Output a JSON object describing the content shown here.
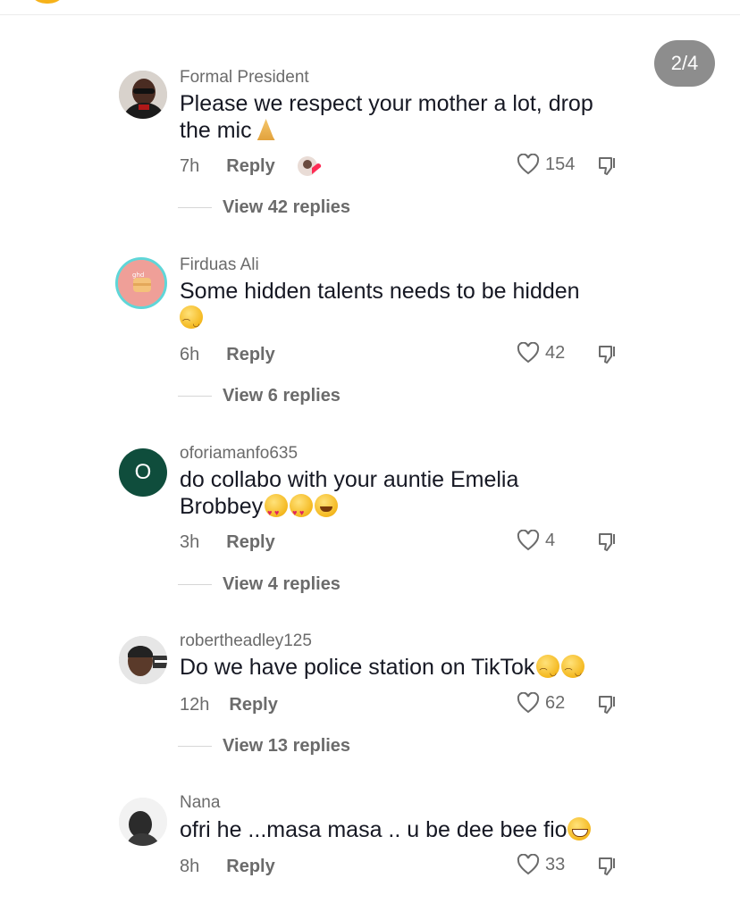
{
  "page_indicator": "2/4",
  "comments": [
    {
      "username": "Formal President",
      "text": "Please we respect your mother a lot, drop the mic",
      "text_line1": "Please we respect your mother a lot, drop",
      "text_line2": "the mic",
      "emoji": "folded-hands",
      "time": "7h",
      "reply_label": "Reply",
      "likes": "154",
      "view_replies": "View 42 replies"
    },
    {
      "username": "Firduas Ali",
      "text_line1": "Some hidden talents needs to be hidden",
      "emoji": "smirk",
      "time": "6h",
      "reply_label": "Reply",
      "likes": "42",
      "view_replies": "View 6 replies"
    },
    {
      "username": "oforiamanfo635",
      "avatar_letter": "O",
      "text_line1": "do collabo with your auntie Emelia",
      "text_line2": "Brobbey",
      "time": "3h",
      "reply_label": "Reply",
      "likes": "4",
      "view_replies": "View 4 replies"
    },
    {
      "username": "robertheadley125",
      "text_line1": "Do we have police station on TikTok",
      "time": "12h",
      "reply_label": "Reply",
      "likes": "62",
      "view_replies": "View 13 replies"
    },
    {
      "username": "Nana",
      "text_line1": "ofri he ...masa masa .. u be dee bee fio",
      "time": "8h",
      "reply_label": "Reply",
      "likes": "33"
    }
  ],
  "colors": {
    "text_primary": "#161823",
    "text_secondary": "#6b6b6b",
    "badge_bg": "#8d8d8d",
    "avatar_green": "#0f4d3c",
    "avatar_ring": "#5fd6d8"
  }
}
